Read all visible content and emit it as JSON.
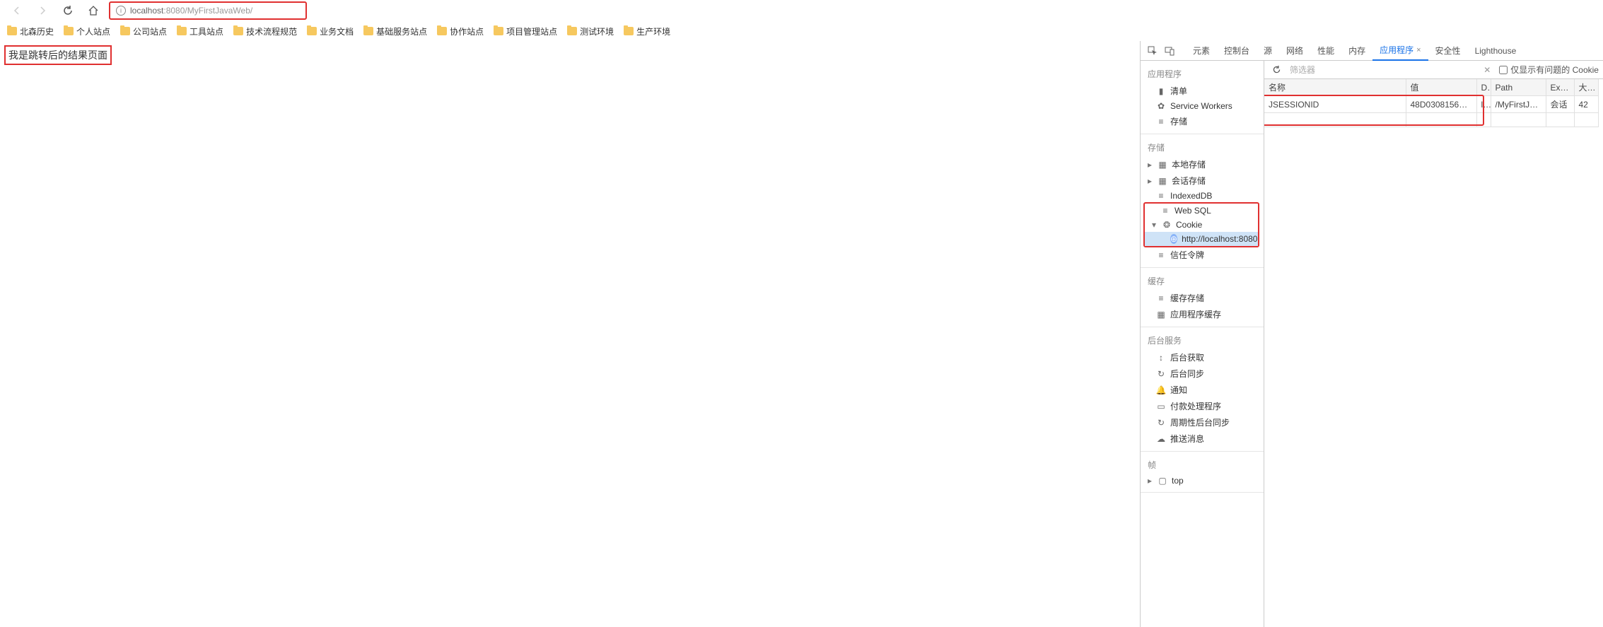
{
  "browser": {
    "url_host": "localhost",
    "url_port": ":8080",
    "url_path": "/MyFirstJavaWeb/"
  },
  "bookmarks": [
    "北森历史",
    "个人站点",
    "公司站点",
    "工具站点",
    "技术流程规范",
    "业务文档",
    "基础服务站点",
    "协作站点",
    "项目管理站点",
    "测试环境",
    "生产环境"
  ],
  "page": {
    "result_text": "我是跳转后的结果页面"
  },
  "devtools": {
    "tabs": [
      "元素",
      "控制台",
      "源",
      "网络",
      "性能",
      "内存",
      "应用程序",
      "安全性",
      "Lighthouse"
    ],
    "active_tab": "应用程序",
    "filter_placeholder": "筛选器",
    "only_issues_label": "仅显示有问题的 Cookie",
    "sidebar": {
      "app": {
        "title": "应用程序",
        "items": [
          "清单",
          "Service Workers",
          "存储"
        ]
      },
      "storage": {
        "title": "存储",
        "items": [
          "本地存储",
          "会话存储",
          "IndexedDB",
          "Web SQL",
          "Cookie",
          "信任令牌"
        ],
        "cookie_child": "http://localhost:8080"
      },
      "cache": {
        "title": "缓存",
        "items": [
          "缓存存储",
          "应用程序缓存"
        ]
      },
      "bg": {
        "title": "后台服务",
        "items": [
          "后台获取",
          "后台同步",
          "通知",
          "付款处理程序",
          "周期性后台同步",
          "推送消息"
        ]
      },
      "frames": {
        "title": "帧",
        "item": "top"
      }
    },
    "cookies": {
      "headers": {
        "name": "名称",
        "value": "值",
        "d": "D...",
        "path": "Path",
        "expires": "Expir...",
        "size": "大小"
      },
      "rows": [
        {
          "name": "JSESSIONID",
          "value": "48D03081569D930...",
          "d": "l...",
          "path": "/MyFirstJava...",
          "expires": "会话",
          "size": "42"
        }
      ]
    }
  }
}
